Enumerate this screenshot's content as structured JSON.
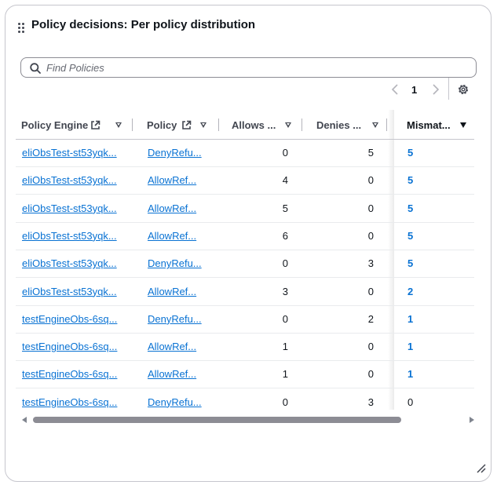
{
  "widget": {
    "title": "Policy decisions: Per policy distribution"
  },
  "search": {
    "placeholder": "Find Policies",
    "value": ""
  },
  "pagination": {
    "current_page": "1"
  },
  "table": {
    "columns": [
      {
        "label": "Policy Engine",
        "external_link": true,
        "sort": "none"
      },
      {
        "label": "Policy",
        "external_link": true,
        "sort": "none"
      },
      {
        "label": "Allows ...",
        "external_link": false,
        "sort": "none"
      },
      {
        "label": "Denies ...",
        "external_link": false,
        "sort": "none"
      },
      {
        "label": "Mismat...",
        "external_link": false,
        "sort": "descending"
      }
    ],
    "rows": [
      {
        "engine": "eliObsTest-st53yqk...",
        "policy": "DenyRefu...",
        "allows": "0",
        "denies": "5",
        "mismatch": "5"
      },
      {
        "engine": "eliObsTest-st53yqk...",
        "policy": "AllowRef...",
        "allows": "4",
        "denies": "0",
        "mismatch": "5"
      },
      {
        "engine": "eliObsTest-st53yqk...",
        "policy": "AllowRef...",
        "allows": "5",
        "denies": "0",
        "mismatch": "5"
      },
      {
        "engine": "eliObsTest-st53yqk...",
        "policy": "AllowRef...",
        "allows": "6",
        "denies": "0",
        "mismatch": "5"
      },
      {
        "engine": "eliObsTest-st53yqk...",
        "policy": "DenyRefu...",
        "allows": "0",
        "denies": "3",
        "mismatch": "5"
      },
      {
        "engine": "eliObsTest-st53yqk...",
        "policy": "AllowRef...",
        "allows": "3",
        "denies": "0",
        "mismatch": "2"
      },
      {
        "engine": "testEngineObs-6sq...",
        "policy": "DenyRefu...",
        "allows": "0",
        "denies": "2",
        "mismatch": "1"
      },
      {
        "engine": "testEngineObs-6sq...",
        "policy": "AllowRef...",
        "allows": "1",
        "denies": "0",
        "mismatch": "1"
      },
      {
        "engine": "testEngineObs-6sq...",
        "policy": "AllowRef...",
        "allows": "1",
        "denies": "0",
        "mismatch": "1"
      },
      {
        "engine": "testEngineObs-6sq...",
        "policy": "DenyRefu...",
        "allows": "0",
        "denies": "3",
        "mismatch": "0"
      }
    ]
  },
  "colors": {
    "link": "#0972d3",
    "text": "#0f141a",
    "border": "#c6c6cd"
  },
  "icons": {
    "drag": "drag-handle-icon",
    "search": "search-icon",
    "prev": "chevron-left-icon",
    "next": "chevron-right-icon",
    "settings": "gear-icon",
    "external": "external-link-icon",
    "resize": "resize-handle-icon"
  }
}
